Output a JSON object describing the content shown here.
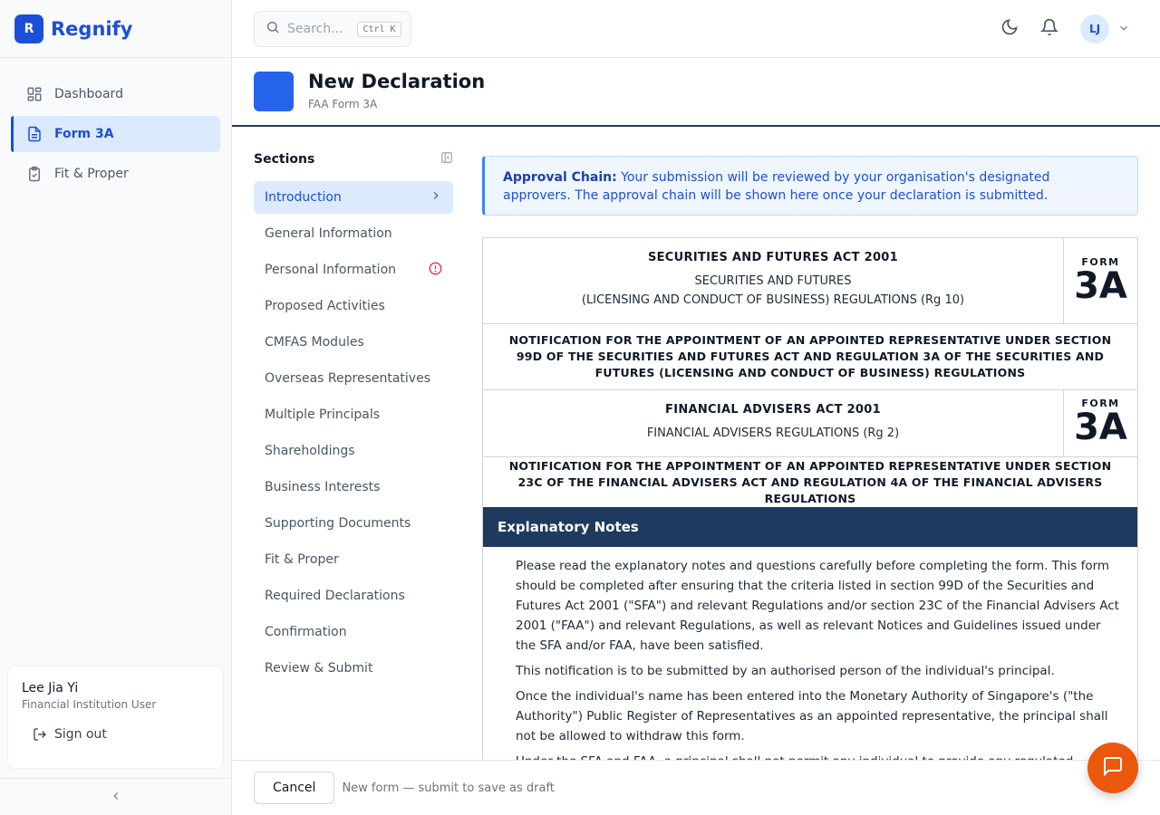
{
  "brand": {
    "logo_letter": "R",
    "name": "Regnify"
  },
  "nav": {
    "items": [
      {
        "label": "Dashboard",
        "icon": "dashboard-icon"
      },
      {
        "label": "Form 3A",
        "icon": "file-text-icon",
        "active": true
      },
      {
        "label": "Fit & Proper",
        "icon": "clipboard-check-icon"
      }
    ]
  },
  "user": {
    "name": "Lee Jia Yi",
    "role": "Financial Institution User",
    "signout_label": "Sign out"
  },
  "topbar": {
    "search_placeholder": "Search...",
    "search_shortcut": "Ctrl K",
    "avatar_initials": "LJ"
  },
  "page": {
    "title": "New Declaration",
    "subtitle": "FAA Form 3A"
  },
  "sections": {
    "title": "Sections",
    "items": [
      {
        "label": "Introduction"
      },
      {
        "label": "General Information"
      },
      {
        "label": "Personal Information"
      },
      {
        "label": "Proposed Activities"
      },
      {
        "label": "CMFAS Modules"
      },
      {
        "label": "Overseas Representatives"
      },
      {
        "label": "Multiple Principals"
      },
      {
        "label": "Shareholdings"
      },
      {
        "label": "Business Interests"
      },
      {
        "label": "Supporting Documents"
      },
      {
        "label": "Fit & Proper"
      },
      {
        "label": "Required Declarations"
      },
      {
        "label": "Confirmation"
      },
      {
        "label": "Review & Submit"
      }
    ]
  },
  "alert": {
    "label": "Approval Chain:",
    "text": "Your submission will be reviewed by your organisation's designated approvers. The approval chain will be shown here once your declaration is submitted."
  },
  "doc": {
    "sfa_act": "SECURITIES AND FUTURES ACT 2001",
    "sfa_reg_1": "SECURITIES AND FUTURES",
    "sfa_reg_2": "(LICENSING AND CONDUCT OF BUSINESS) REGULATIONS (Rg 10)",
    "form_word": "FORM",
    "form_num": "3A",
    "sfa_notification": "NOTIFICATION FOR THE APPOINTMENT OF AN APPOINTED REPRESENTATIVE UNDER SECTION 99D OF THE SECURITIES AND FUTURES ACT AND REGULATION 3A OF THE SECURITIES AND FUTURES (LICENSING AND CONDUCT OF BUSINESS) REGULATIONS",
    "faa_act": "FINANCIAL ADVISERS ACT 2001",
    "faa_reg": "FINANCIAL ADVISERS REGULATIONS (Rg 2)",
    "faa_notification": "NOTIFICATION FOR THE APPOINTMENT OF AN APPOINTED REPRESENTATIVE UNDER SECTION 23C OF THE FINANCIAL ADVISERS ACT AND REGULATION 4A OF THE FINANCIAL ADVISERS REGULATIONS",
    "explanatory_title": "Explanatory Notes",
    "paragraphs": [
      "Please read the explanatory notes and questions carefully before completing the form. This form should be completed after ensuring that the criteria listed in section 99D of the Securities and Futures Act 2001 (\"SFA\") and relevant Regulations and/or section 23C of the Financial Advisers Act 2001 (\"FAA\") and relevant Regulations, as well as relevant Notices and Guidelines issued under the SFA and/or FAA, have been satisfied.",
      "This notification is to be submitted by an authorised person of the individual's principal.",
      "Once the individual's name has been entered into the Monetary Authority of Singapore's (\"the Authority\") Public Register of Representatives as an appointed representative, the principal shall not be allowed to withdraw this form.",
      "Under the SFA and FAA, a principal shall not permit any individual to provide any regulated activity"
    ]
  },
  "footer": {
    "cancel_label": "Cancel",
    "note": "New form — submit to save as draft"
  },
  "colors": {
    "brand": "#1d4ed8",
    "navy": "#1e3a5f",
    "fab": "#ea580c",
    "error": "#dc2626"
  }
}
